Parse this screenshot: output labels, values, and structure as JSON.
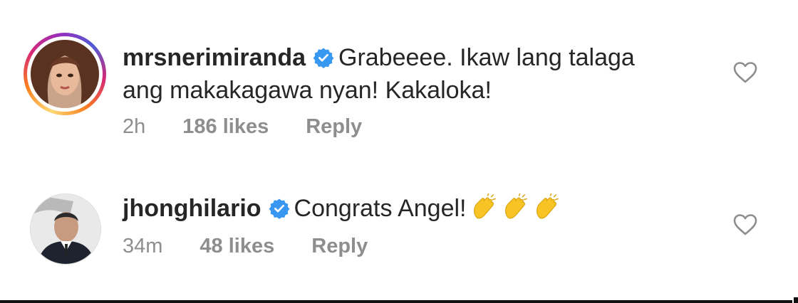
{
  "comments": [
    {
      "username": "mrsnerimiranda",
      "verified": true,
      "text_line1": "Grabeeee. Ikaw lang talaga",
      "text_line2": "ang makakagawa nyan! Kakaloka!",
      "time": "2h",
      "likes": "186 likes",
      "reply": "Reply",
      "avatar": "profile-photo-with-story-ring",
      "icons": [
        "verified-badge-icon",
        "heart-outline-icon"
      ]
    },
    {
      "username": "jhonghilario",
      "verified": true,
      "text": "Congrats Angel!",
      "emoji": [
        "clapping-hands",
        "clapping-hands",
        "clapping-hands"
      ],
      "time": "34m",
      "likes": "48 likes",
      "reply": "Reply",
      "avatar": "profile-photo",
      "icons": [
        "verified-badge-icon",
        "heart-outline-icon"
      ]
    }
  ],
  "colors": {
    "verified_blue": "#3897f0",
    "meta_gray": "#8e8e8e",
    "text": "#262626",
    "clap_yellow": "#f7c325"
  }
}
